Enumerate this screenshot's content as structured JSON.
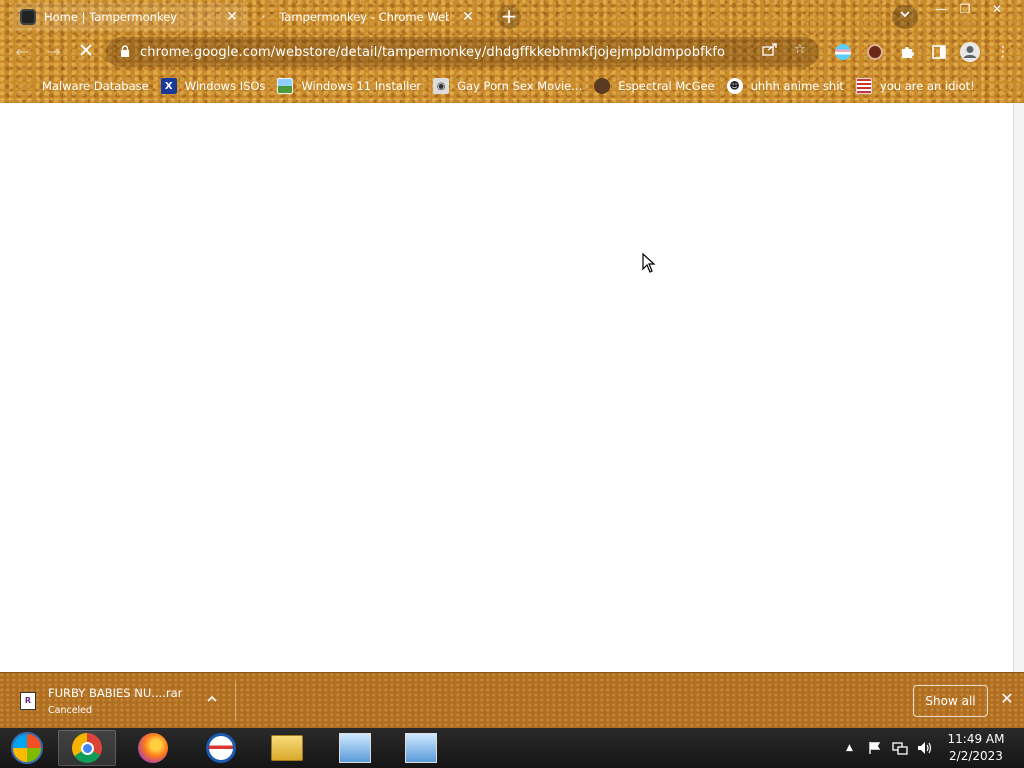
{
  "window_controls": {
    "minimize": "—",
    "restore": "❐",
    "close": "✕"
  },
  "tabs": [
    {
      "title": "Home | Tampermonkey",
      "active": true
    },
    {
      "title": "Tampermonkey - Chrome Web St",
      "active": false
    }
  ],
  "toolbar": {
    "url": "chrome.google.com/webstore/detail/tampermonkey/dhdgffkkebhmkfjojejmpbldmpobfkfo"
  },
  "bookmarks": [
    {
      "label": "Malware Database",
      "icon": "globe-icon"
    },
    {
      "label": "Windows ISOs",
      "icon": "x-logo-icon"
    },
    {
      "label": "Windows 11 Installer",
      "icon": "image-icon"
    },
    {
      "label": "Gay Porn Sex Movie...",
      "icon": "site-icon"
    },
    {
      "label": "Espectral McGee",
      "icon": "face-icon"
    },
    {
      "label": "uhhh anime shit",
      "icon": "anime-icon"
    },
    {
      "label": "you are an idiot!",
      "icon": "flag-icon"
    }
  ],
  "download": {
    "filename": "FURBY BABIES NU....rar",
    "status": "Canceled",
    "show_all": "Show all"
  },
  "taskbar": {
    "apps": [
      "start-orb",
      "chrome",
      "firefox",
      "opera",
      "file-explorer",
      "setup-1",
      "setup-2"
    ],
    "time": "11:49 AM",
    "date": "2/2/2023"
  },
  "colors": {
    "frame": "#c98a2c",
    "download_shelf": "#b06e22",
    "taskbar": "#1b1b1b"
  }
}
